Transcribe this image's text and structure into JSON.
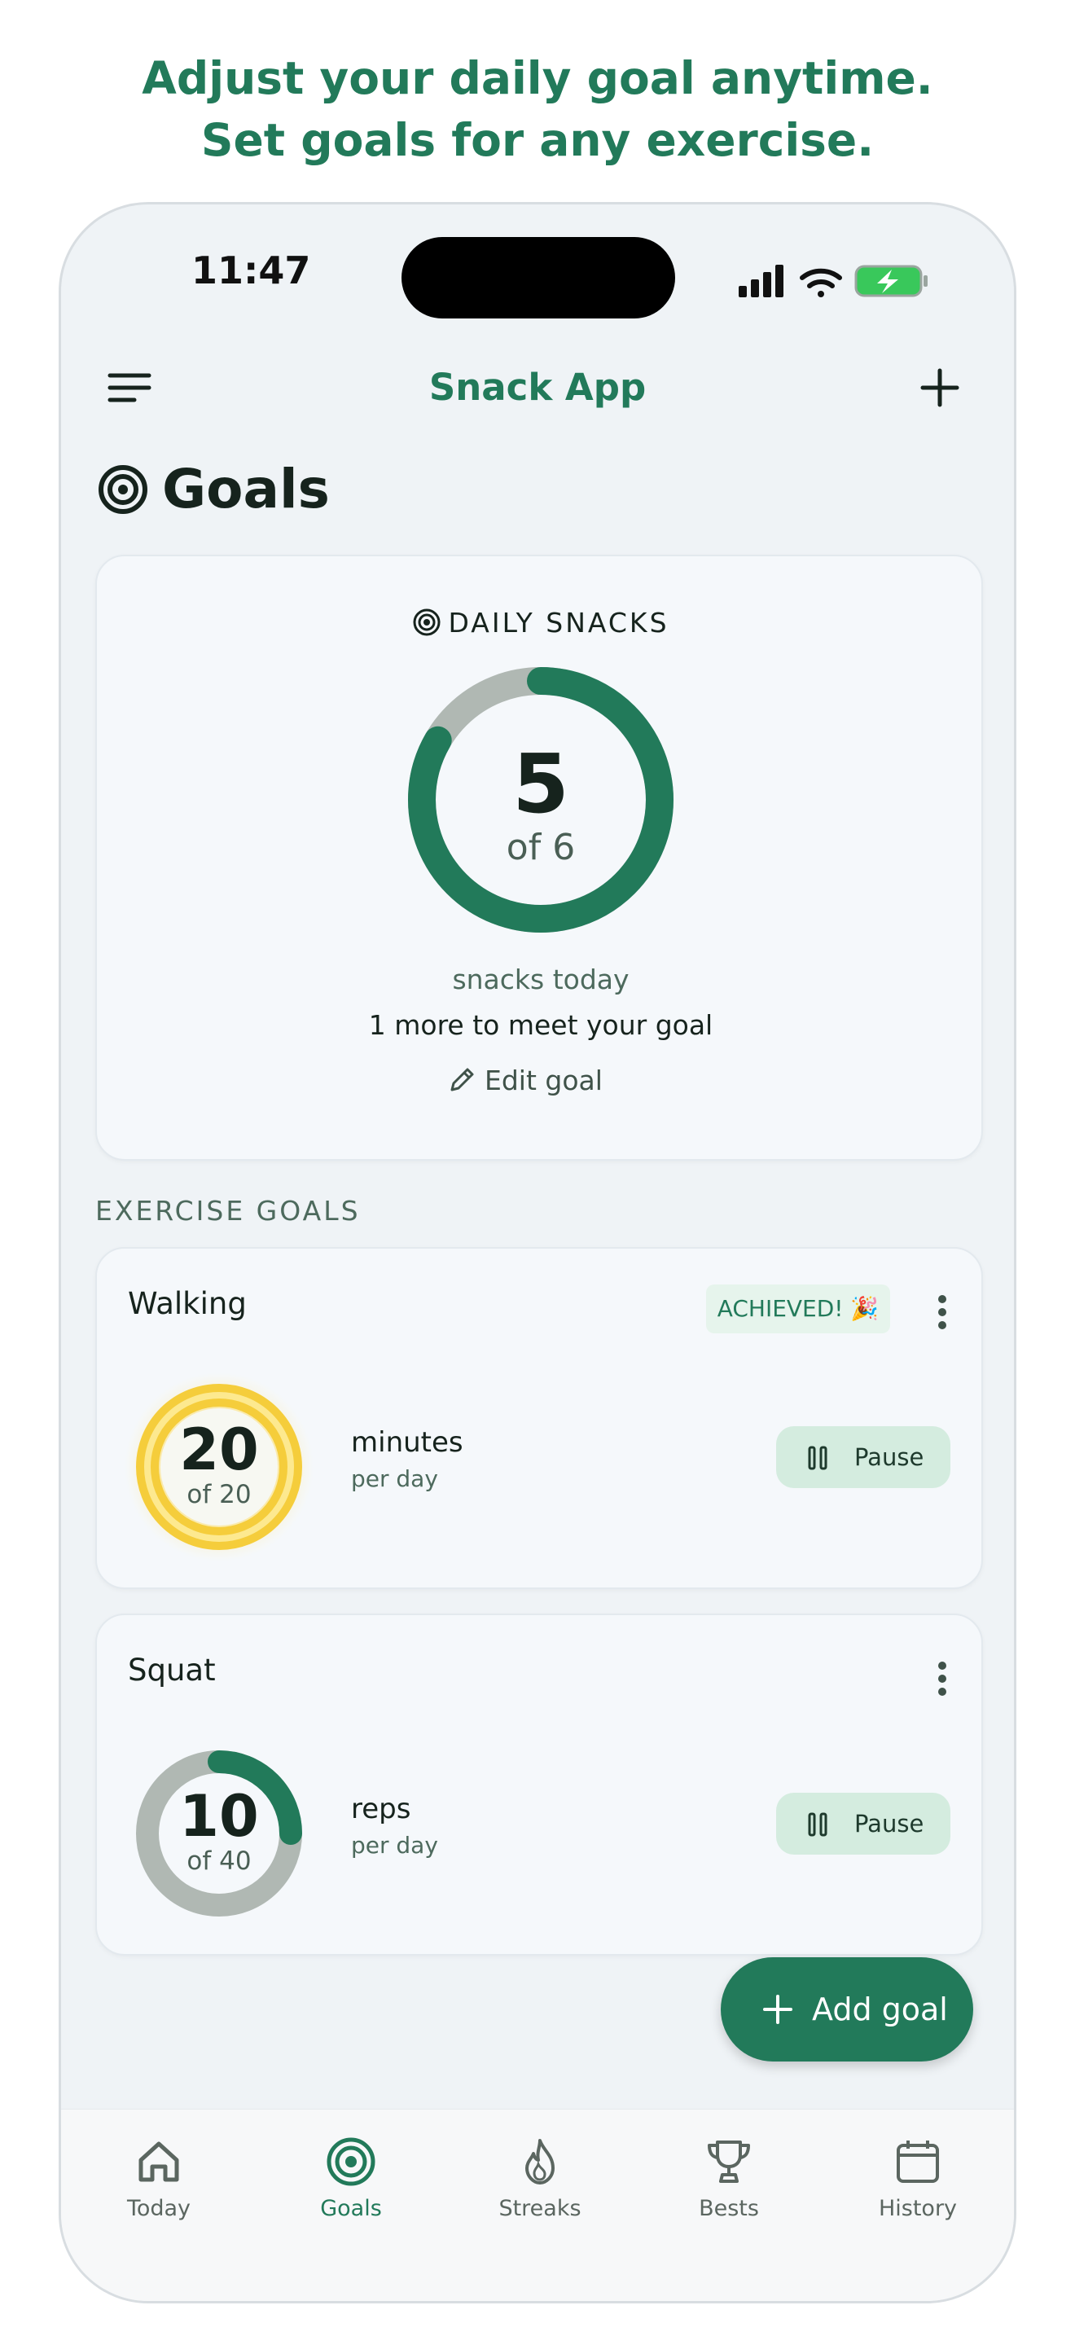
{
  "promo": {
    "line1": "Adjust your daily goal anytime.",
    "line2": "Set goals for any exercise."
  },
  "status_bar": {
    "time": "11:47"
  },
  "app_bar": {
    "title": "Snack App"
  },
  "page": {
    "title": "Goals"
  },
  "daily": {
    "label": "DAILY SNACKS",
    "count": "5",
    "of_text": "of 6",
    "progress": 0.8333,
    "subtitle": "snacks today",
    "message": "1 more to meet your goal",
    "edit_label": "Edit goal"
  },
  "exercise_section": {
    "label": "EXERCISE GOALS"
  },
  "goals": [
    {
      "name": "Walking",
      "badge": "ACHIEVED! 🎉",
      "value": "20",
      "of_text": "of 20",
      "progress": 1.0,
      "unit": "minutes",
      "period": "per day",
      "pause_label": "Pause"
    },
    {
      "name": "Squat",
      "value": "10",
      "of_text": "of 40",
      "progress": 0.25,
      "unit": "reps",
      "period": "per day",
      "pause_label": "Pause"
    }
  ],
  "fab": {
    "label": "Add goal"
  },
  "tabs": [
    {
      "label": "Today",
      "icon": "home-icon"
    },
    {
      "label": "Goals",
      "icon": "target-icon",
      "active": true
    },
    {
      "label": "Streaks",
      "icon": "flame-icon"
    },
    {
      "label": "Bests",
      "icon": "trophy-icon"
    },
    {
      "label": "History",
      "icon": "calendar-icon"
    }
  ],
  "colors": {
    "brand": "#227a5a",
    "ring_track": "#b0b8b3",
    "achieved_gold": "#f5cd3b",
    "badge_bg": "#e6f4ec",
    "pause_bg": "#d4ecdf"
  }
}
